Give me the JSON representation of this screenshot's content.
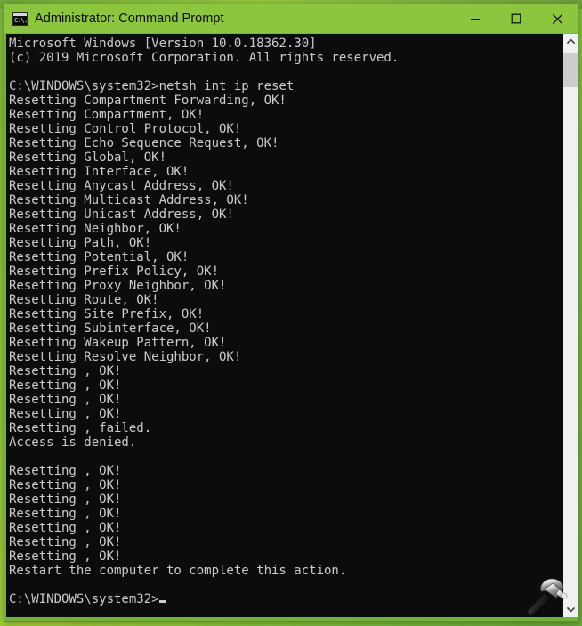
{
  "window": {
    "title": "Administrator: Command Prompt",
    "icon": "command-prompt-icon",
    "icon_glyph": "C:\\.",
    "titlebar_color": "#8cc63f",
    "console_bg": "#0c0c0c",
    "console_fg": "#cccccc",
    "controls": {
      "minimize_label": "Minimize",
      "maximize_label": "Maximize",
      "close_label": "Close"
    }
  },
  "desktop": {
    "background_color": "#8cc63f"
  },
  "console": {
    "lines": [
      "Microsoft Windows [Version 10.0.18362.30]",
      "(c) 2019 Microsoft Corporation. All rights reserved.",
      "",
      "C:\\WINDOWS\\system32>netsh int ip reset",
      "Resetting Compartment Forwarding, OK!",
      "Resetting Compartment, OK!",
      "Resetting Control Protocol, OK!",
      "Resetting Echo Sequence Request, OK!",
      "Resetting Global, OK!",
      "Resetting Interface, OK!",
      "Resetting Anycast Address, OK!",
      "Resetting Multicast Address, OK!",
      "Resetting Unicast Address, OK!",
      "Resetting Neighbor, OK!",
      "Resetting Path, OK!",
      "Resetting Potential, OK!",
      "Resetting Prefix Policy, OK!",
      "Resetting Proxy Neighbor, OK!",
      "Resetting Route, OK!",
      "Resetting Site Prefix, OK!",
      "Resetting Subinterface, OK!",
      "Resetting Wakeup Pattern, OK!",
      "Resetting Resolve Neighbor, OK!",
      "Resetting , OK!",
      "Resetting , OK!",
      "Resetting , OK!",
      "Resetting , OK!",
      "Resetting , failed.",
      "Access is denied.",
      "",
      "Resetting , OK!",
      "Resetting , OK!",
      "Resetting , OK!",
      "Resetting , OK!",
      "Resetting , OK!",
      "Resetting , OK!",
      "Resetting , OK!",
      "Restart the computer to complete this action.",
      ""
    ],
    "prompt": "C:\\WINDOWS\\system32>",
    "cursor": "block-underscore"
  },
  "scrollbar": {
    "up_arrow": "chevron-up-icon",
    "down_arrow": "chevron-down-icon",
    "thumb_position": "near-top"
  },
  "cursor": {
    "type": "hammer-cursor"
  }
}
